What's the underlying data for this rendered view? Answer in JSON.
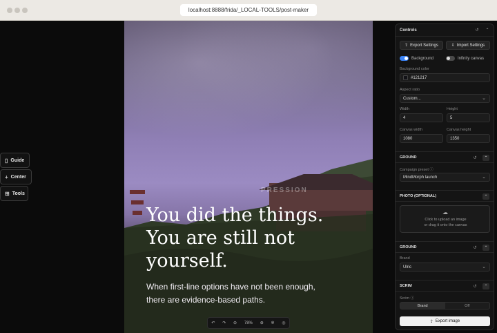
{
  "browser": {
    "url": "localhost:8888/frida/_LOCAL-TOOLS/post-maker"
  },
  "left_buttons": [
    {
      "label": "Guide",
      "icon": "book-icon"
    },
    {
      "label": "Center",
      "icon": "plus-icon"
    },
    {
      "label": "Tools",
      "icon": "grid-icon"
    }
  ],
  "poster": {
    "watermark": "PRESSION",
    "headline_lines": [
      "You did the things.",
      "You are still not",
      "yourself."
    ],
    "sub_lines": [
      "When first-line options have not been enough,",
      "there are evidence-based paths."
    ]
  },
  "zoom": {
    "level": "78%"
  },
  "controls": {
    "title": "Controls",
    "export_settings": "Export Settings",
    "import_settings": "Import Settings",
    "background_toggle": {
      "label": "Background",
      "on": true
    },
    "infinity_toggle": {
      "label": "Infinity canvas",
      "on": false
    },
    "background_color_label": "Background color",
    "background_color_value": "#121217",
    "aspect_ratio_label": "Aspect ratio",
    "aspect_ratio_value": "Custom...",
    "width_label": "Width",
    "width_value": "4",
    "height_label": "Height",
    "height_value": "5",
    "canvas_width_label": "Canvas width",
    "canvas_width_value": "1080",
    "canvas_height_label": "Canvas height",
    "canvas_height_value": "1350",
    "section_ground": "GROUND",
    "campaign_preset_label": "Campaign preset",
    "campaign_preset_value": "MindMorph launch",
    "section_photo": "PHOTO (OPTIONAL)",
    "upload_line1": "Click to upload an image",
    "upload_line2": "or drag it onto the canvas",
    "section_ground2": "GROUND",
    "brand_label": "Brand",
    "brand_value": "Ulric",
    "section_scrim": "SCRIM",
    "scrim_label": "Scrim",
    "scrim_options": [
      "Brand",
      "Off"
    ],
    "export_image": "Export image"
  }
}
